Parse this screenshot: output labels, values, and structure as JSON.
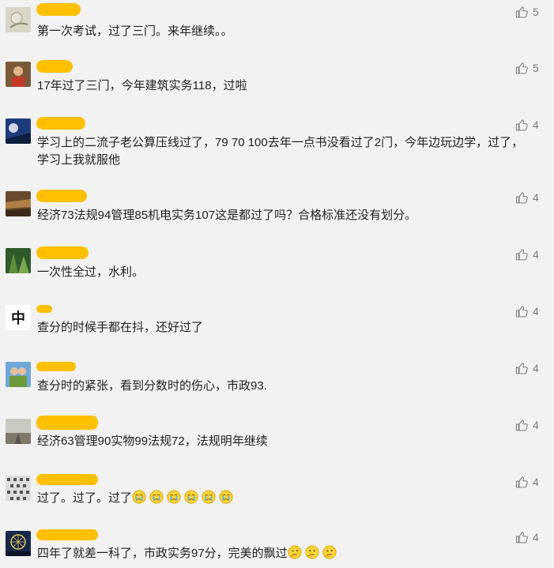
{
  "comments": [
    {
      "text": "第一次考试，过了三门。来年继续。。",
      "likes": "5",
      "avatar_icon": "flower-avatar-icon"
    },
    {
      "text": "17年过了三门，今年建筑实务118，过啦",
      "likes": "5",
      "avatar_icon": "person-avatar-icon"
    },
    {
      "text": "学习上的二流子老公算压线过了，79   70     100去年一点书没看过了2门，今年边玩边学，过了，学习上我就服他",
      "likes": "4",
      "avatar_icon": "artwork-avatar-icon"
    },
    {
      "text": "经济73法规94管理85机电实务107这是都过了吗？合格标准还没有划分。",
      "likes": "4",
      "avatar_icon": "landscape-avatar-icon"
    },
    {
      "text": "一次性全过，水利。",
      "likes": "4",
      "avatar_icon": "forest-avatar-icon"
    },
    {
      "text": "查分的时候手都在抖，还好过了",
      "likes": "4",
      "avatar_icon": "character-avatar-icon",
      "avatar_char": "中"
    },
    {
      "text": "查分时的紧张，看到分数时的伤心，市政93.",
      "likes": "4",
      "avatar_icon": "couple-avatar-icon"
    },
    {
      "text": "经济63管理90实物99法规72，法规明年继续",
      "likes": "4",
      "avatar_icon": "road-avatar-icon"
    },
    {
      "text": "过了。过了。过了",
      "likes": "4",
      "avatar_icon": "pattern-avatar-icon",
      "emoji": "crying-face-emoji",
      "emoji_count": 6
    },
    {
      "text": "四年了就差一科了，市政实务97分，完美的飘过",
      "likes": "4",
      "avatar_icon": "ferris-wheel-avatar-icon",
      "emoji": "thinking-face-emoji",
      "emoji_count": 3
    }
  ],
  "colors": {
    "name_mask": "#ffc000",
    "background": "#f2f2f2",
    "like_icon": "#7d7d7d"
  }
}
